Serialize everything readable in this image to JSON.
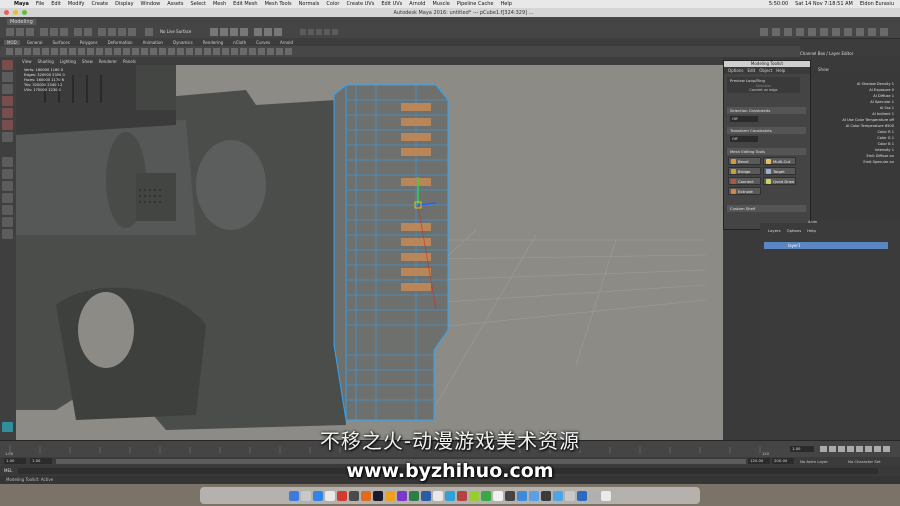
{
  "mac_menubar": {
    "app": "Maya",
    "items": [
      "File",
      "Edit",
      "Modify",
      "Create",
      "Display",
      "Window",
      "Assets",
      "Select",
      "Mesh",
      "Edit Mesh",
      "Mesh Tools",
      "Normals",
      "Color",
      "Create UVs",
      "Edit UVs",
      "Arnold",
      "Muscle",
      "Pipeline Cache",
      "Help"
    ],
    "clock": "Sat 14 Nov  7:18:51 AM",
    "user": "Eldon Eurasiu",
    "time_small": "5:50:00"
  },
  "window": {
    "title": "Autodesk Maya 2016: untitled*   ---   pCube1.f[324:329] ..."
  },
  "statusline": {
    "mode": "Modeling",
    "live_surface": "No Live Surface"
  },
  "shelf_tabs": [
    "MOD",
    "General",
    "Surfaces",
    "Polygons",
    "Deformation",
    "Animation",
    "Dynamics",
    "Rendering",
    "nCloth",
    "Curves",
    "Arnold"
  ],
  "panel_menu": [
    "View",
    "Shading",
    "Lighting",
    "Show",
    "Renderer",
    "Panels"
  ],
  "hud": {
    "rows": [
      [
        "Verts:",
        "160000",
        "1160",
        "0"
      ],
      [
        "Edges:",
        "320000",
        "2350",
        "0"
      ],
      [
        "Faces:",
        "160000",
        "1170",
        "6"
      ],
      [
        "Tris:",
        "320000",
        "2340",
        "12"
      ],
      [
        "UVs:",
        "170000",
        "1230",
        "0"
      ]
    ]
  },
  "right_header": {
    "tabs": "Channel Box / Layer Editor",
    "show": "Show"
  },
  "attributes": [
    "AI Shadow Density 1",
    "AI Exposure 0",
    "AI Diffuse 1",
    "AI Specular 1",
    "AI Sss 1",
    "AI Indirect 1",
    "AI Use Color Temperature off",
    "AI Color Temperature 6500",
    "Color R 1",
    "Color G 1",
    "Color B 1",
    "Intensity 1",
    "Emit Diffuse on",
    "Emit Specular on"
  ],
  "modeling_toolkit": {
    "title": "Modeling Toolkit",
    "menu": [
      "Options",
      "Edit",
      "Object",
      "Help"
    ],
    "preview_button": "Preview Loop/Ring",
    "selection_label": "Selection",
    "selection_hint": "Convert on edge",
    "selection_constraints": "Selection Constraints",
    "off1": "Off",
    "transform_constraints": "Transform Constraints",
    "off2": "Off",
    "mesh_editing": "Mesh Editing Tools",
    "tools": [
      "Bevel",
      "Multi-Cut",
      "Bridge",
      "Target Weld",
      "Connect",
      "Quad Draw",
      "Extrude"
    ],
    "custom_shelf": "Custom Shelf"
  },
  "layer_editor": {
    "menu": [
      "Layers",
      "Options",
      "Help"
    ],
    "layer_name": "layer1",
    "anim_label": "Anim"
  },
  "timeline": {
    "start": "1.00",
    "end": "120",
    "current": "1.00",
    "range_start": "1.00",
    "range_inner": "1.00",
    "range_out": "120.00",
    "range_end": "200.00",
    "anim_layer": "No Anim Layer",
    "char_set": "No Character Set",
    "mel": "MEL"
  },
  "helpline": {
    "text": "Modeling Toolkit: Active"
  },
  "watermark": {
    "line1": "不移之火-动漫游戏美术资源",
    "line2": "www.byzhihuo.com"
  },
  "dock_colors": [
    "#3d7be0",
    "#c8c8c8",
    "#2f86e8",
    "#e8e8e8",
    "#d33a2f",
    "#4b4b4b",
    "#e06b1a",
    "#1a1a2e",
    "#f0a020",
    "#7a38c8",
    "#2d7d46",
    "#2a5ca8",
    "#e8e8e8",
    "#2fa0d8",
    "#b14343",
    "#9acd32",
    "#39a845",
    "#f0f0f0",
    "#444",
    "#3d8ad9",
    "#5aa0e6",
    "#3a3a3a",
    "#4ba6e6",
    "#c9c9c9",
    "#2b6bbf",
    "#b0b0b0",
    "#eaeaea"
  ]
}
